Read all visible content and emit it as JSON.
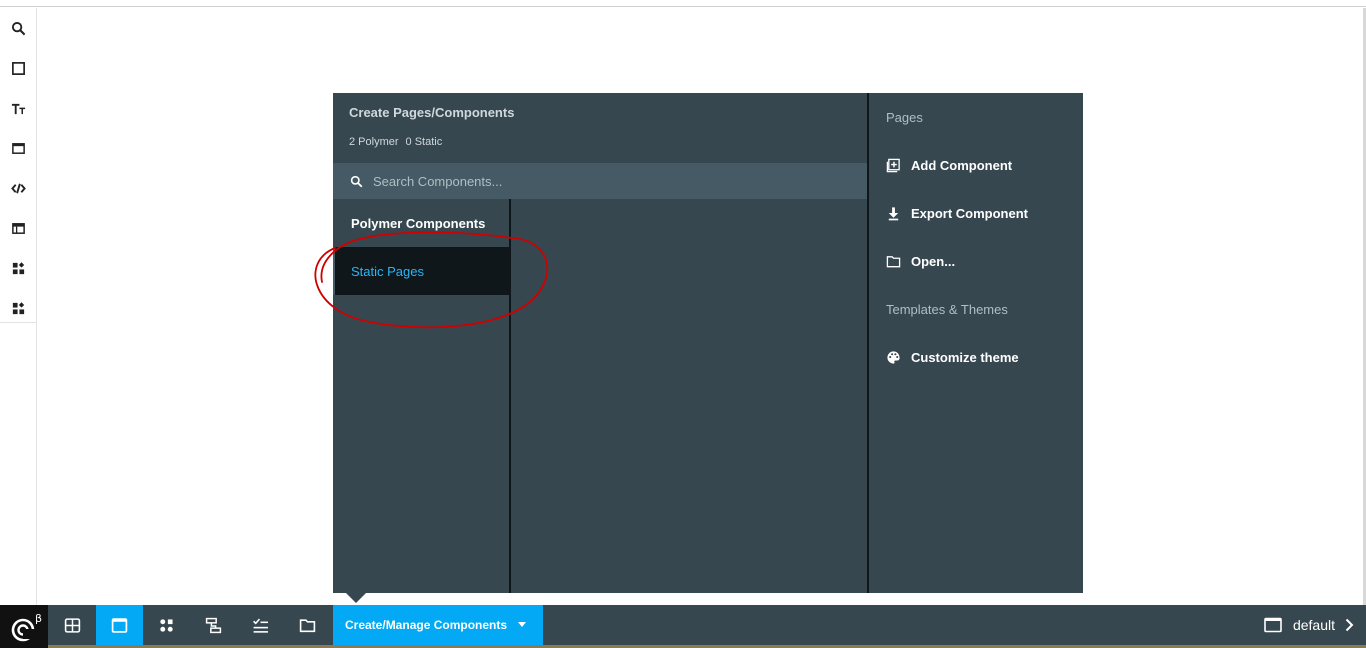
{
  "popup": {
    "title": "Create Pages/Components",
    "counts": {
      "polymer": "2 Polymer",
      "static": "0 Static"
    },
    "search": {
      "placeholder": "Search Components..."
    },
    "categories": [
      {
        "label": "Polymer Components"
      },
      {
        "label": "Static Pages"
      }
    ],
    "right": {
      "pages_heading": "Pages",
      "add_component": "Add Component",
      "export_component": "Export Component",
      "open": "Open...",
      "templates_heading": "Templates & Themes",
      "customize_theme": "Customize theme"
    }
  },
  "bottom_bar": {
    "logo_superscript": "β",
    "mode_label": "Create/Manage Components",
    "device_label": "default"
  },
  "annotation": {
    "color": "#d00000"
  },
  "colors": {
    "panel": "#37474f",
    "panel_dark": "#0f171b",
    "accent": "#03a9f4",
    "link_active": "#29b6f6"
  }
}
